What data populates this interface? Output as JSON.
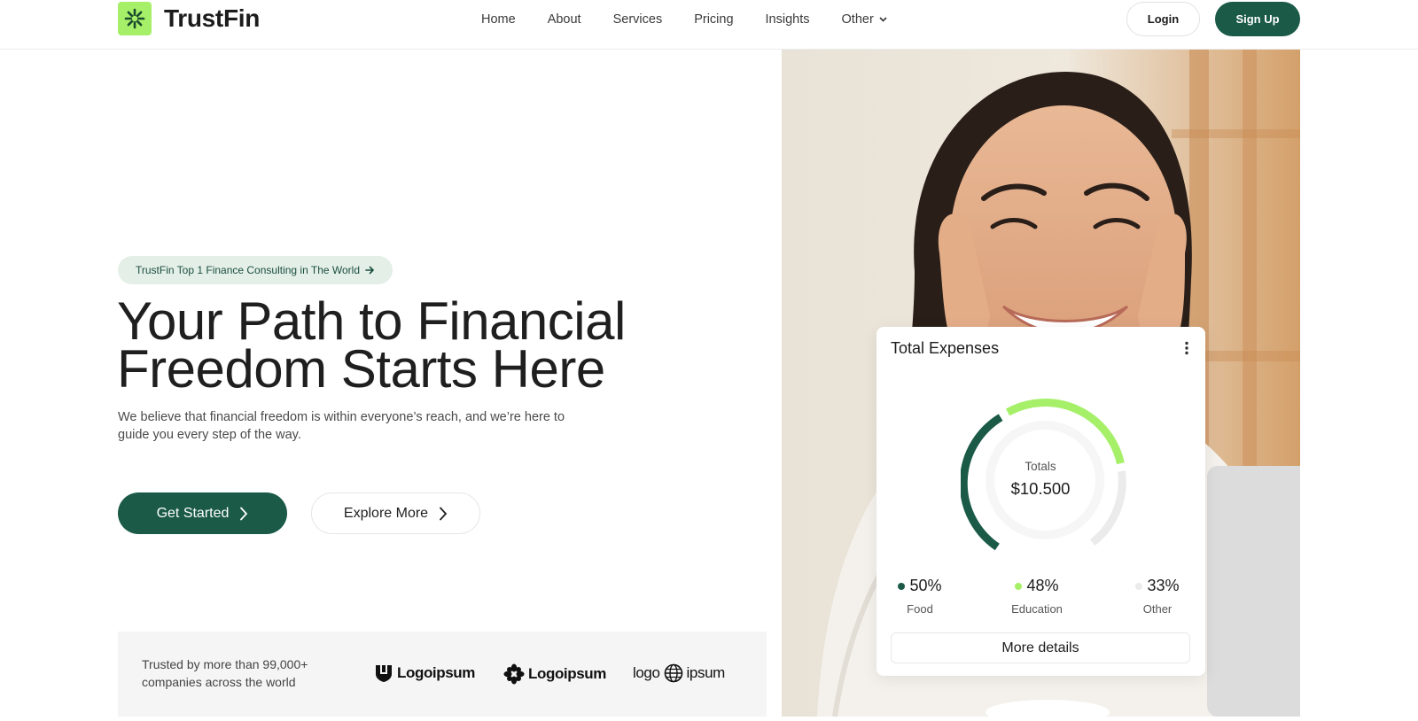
{
  "brand": {
    "name": "TrustFin",
    "accent": "#a6f069",
    "primary": "#1a5a47",
    "logo_icon": "starburst-icon"
  },
  "nav": {
    "items": [
      {
        "label": "Home"
      },
      {
        "label": "About"
      },
      {
        "label": "Services"
      },
      {
        "label": "Pricing"
      },
      {
        "label": "Insights"
      },
      {
        "label": "Other"
      }
    ]
  },
  "auth": {
    "login": "Login",
    "signup": "Sign Up"
  },
  "hero": {
    "badge": "TrustFin Top 1 Finance Consulting in The World",
    "title_line1": "Your Path to Financial",
    "title_line2": "Freedom Starts Here",
    "subtitle": "We believe that financial freedom is within everyone’s reach, and we’re here to guide you every step of the way.",
    "cta_primary": "Get Started",
    "cta_secondary": "Explore More"
  },
  "trusted": {
    "text": "Trusted by more than 99,000+ companies across the world",
    "logos": [
      "Logoipsum",
      "Logoipsum",
      "logo",
      "ipsum"
    ]
  },
  "expenses_card": {
    "title": "Total Expenses",
    "totals_label": "Totals",
    "totals_value": "$10.500",
    "legend": [
      {
        "pct": "50%",
        "label": "Food",
        "color": "#1a5a47"
      },
      {
        "pct": "48%",
        "label": "Education",
        "color": "#a6f069"
      },
      {
        "pct": "33%",
        "label": "Other",
        "color": "#ebebeb"
      }
    ],
    "details_button": "More details"
  }
}
